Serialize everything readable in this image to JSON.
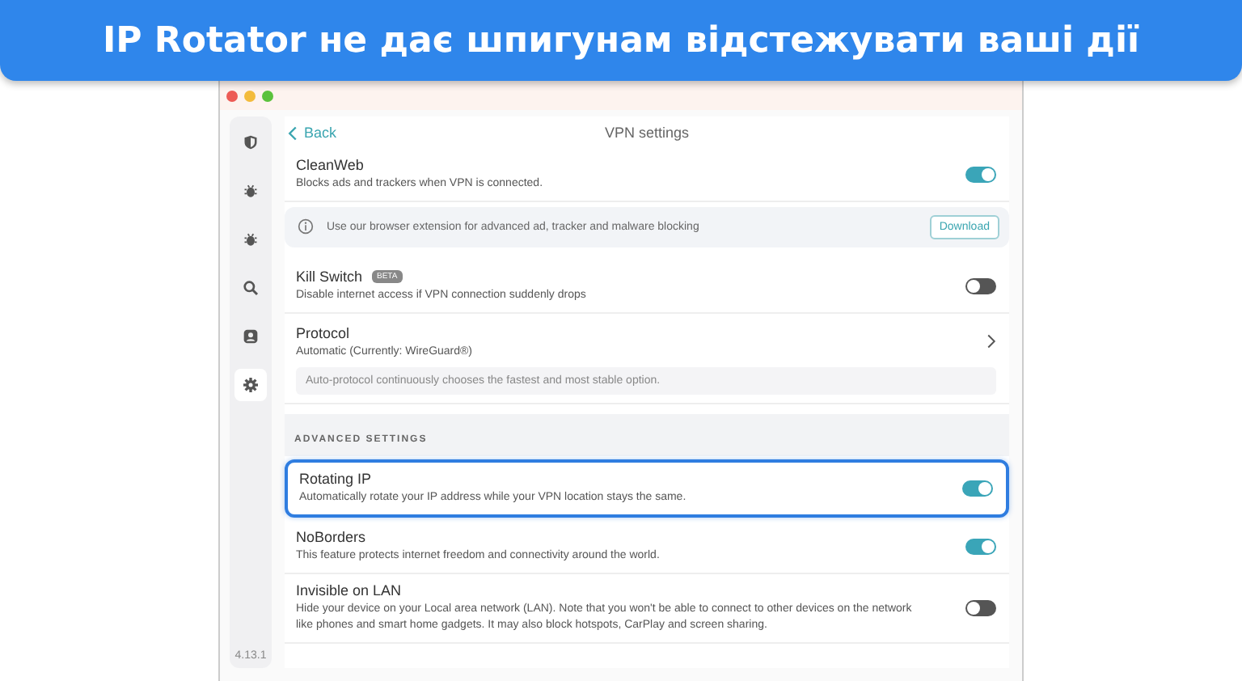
{
  "banner": {
    "title": "IP Rotator не дає шпигунам відстежувати ваші дії"
  },
  "sidebar": {
    "items": [
      {
        "kind": "shield",
        "selected": false
      },
      {
        "kind": "bug",
        "selected": false
      },
      {
        "kind": "bug",
        "selected": false
      },
      {
        "kind": "search",
        "selected": false
      },
      {
        "kind": "user",
        "selected": false
      },
      {
        "kind": "gear",
        "selected": true
      }
    ],
    "version": "4.13.1"
  },
  "header": {
    "back": "Back",
    "title": "VPN settings"
  },
  "rows": [
    {
      "kind": "toggle",
      "title": "CleanWeb",
      "description": "Blocks ads and trackers when VPN is connected.",
      "on": true,
      "highlighted": false
    },
    {
      "kind": "info",
      "text": "Use our browser extension for advanced ad, tracker and malware blocking",
      "button": "Download"
    },
    {
      "kind": "toggle",
      "title": "Kill Switch",
      "badge": "BETA",
      "description": "Disable internet access if VPN connection suddenly drops",
      "on": false,
      "highlighted": false
    },
    {
      "kind": "link",
      "title": "Protocol",
      "description": "Automatic (Currently: WireGuard®)",
      "note": "Auto-protocol continuously chooses the fastest and most stable option."
    },
    {
      "kind": "section",
      "text": "ADVANCED SETTINGS"
    },
    {
      "kind": "toggle",
      "title": "Rotating IP",
      "description": "Automatically rotate your IP address while your VPN location stays the same.",
      "on": true,
      "highlighted": true
    },
    {
      "kind": "toggle",
      "title": "NoBorders",
      "description": "This feature protects internet freedom and connectivity around the world.",
      "on": true,
      "highlighted": false
    },
    {
      "kind": "toggle",
      "title": "Invisible on LAN",
      "description": "Hide your device on your Local area network (LAN). Note that you won't be able to connect to other devices on the network like phones and smart home gadgets. It may also block hotspots, CarPlay and screen sharing.",
      "on": false,
      "highlighted": false
    }
  ]
}
